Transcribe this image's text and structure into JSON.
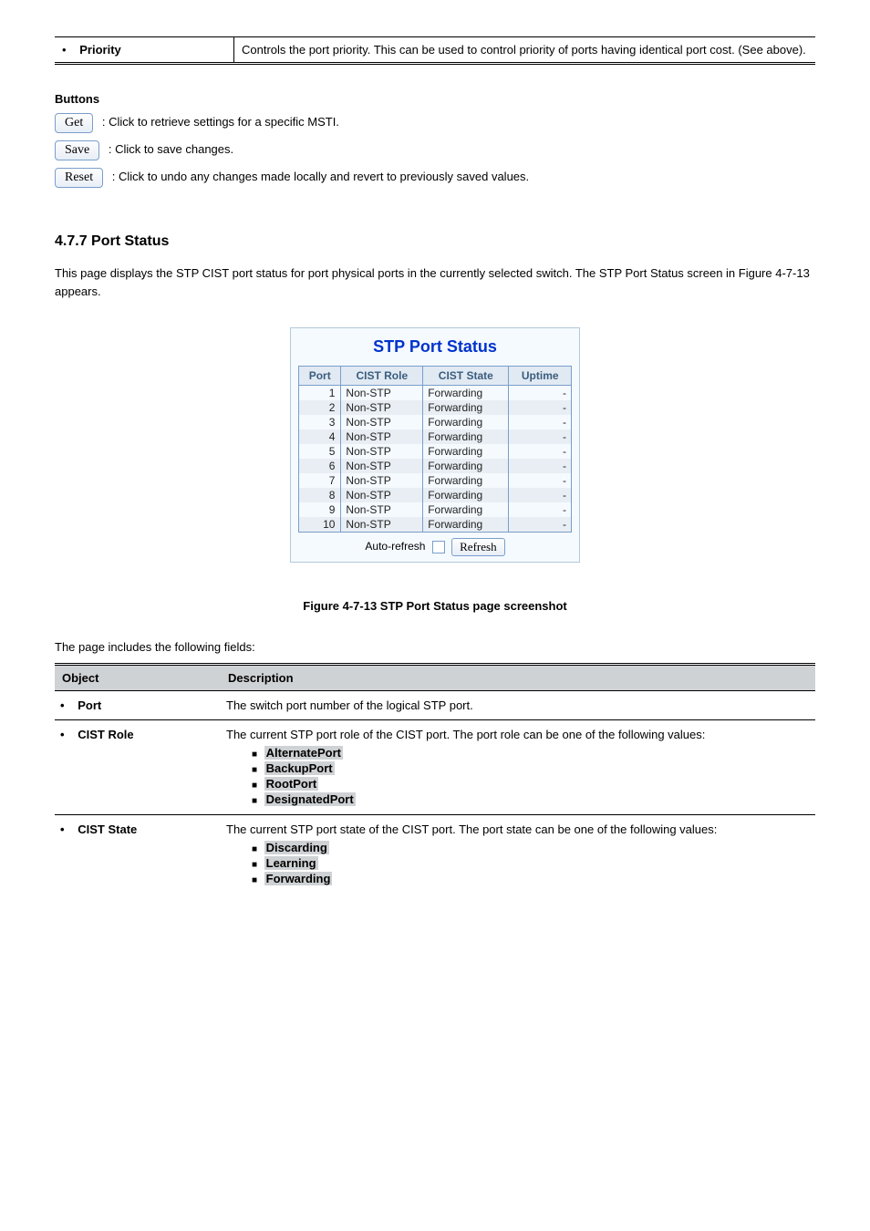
{
  "row1": {
    "label": "Priority",
    "desc": "Controls the port priority. This can be used to control priority of ports having identical port cost. (See above)."
  },
  "buttons": {
    "intro": "Buttons",
    "get": "Get",
    "get_desc": ": Click to retrieve settings for a specific MSTI.",
    "save": "Save",
    "save_desc": ": Click to save changes.",
    "reset": "Reset",
    "reset_desc": ": Click to undo any changes made locally and revert to previously saved values."
  },
  "section": {
    "heading": "4.7.7 Port Status",
    "body": "This page displays the STP CIST port status for port physical ports in the currently selected switch. The STP Port Status screen in Figure 4-7-13 appears."
  },
  "panel": {
    "title": "STP Port Status",
    "headers": [
      "Port",
      "CIST Role",
      "CIST State",
      "Uptime"
    ],
    "rows": [
      {
        "port": "1",
        "role": "Non-STP",
        "state": "Forwarding",
        "uptime": "-"
      },
      {
        "port": "2",
        "role": "Non-STP",
        "state": "Forwarding",
        "uptime": "-"
      },
      {
        "port": "3",
        "role": "Non-STP",
        "state": "Forwarding",
        "uptime": "-"
      },
      {
        "port": "4",
        "role": "Non-STP",
        "state": "Forwarding",
        "uptime": "-"
      },
      {
        "port": "5",
        "role": "Non-STP",
        "state": "Forwarding",
        "uptime": "-"
      },
      {
        "port": "6",
        "role": "Non-STP",
        "state": "Forwarding",
        "uptime": "-"
      },
      {
        "port": "7",
        "role": "Non-STP",
        "state": "Forwarding",
        "uptime": "-"
      },
      {
        "port": "8",
        "role": "Non-STP",
        "state": "Forwarding",
        "uptime": "-"
      },
      {
        "port": "9",
        "role": "Non-STP",
        "state": "Forwarding",
        "uptime": "-"
      },
      {
        "port": "10",
        "role": "Non-STP",
        "state": "Forwarding",
        "uptime": "-"
      }
    ],
    "auto_refresh_label": "Auto-refresh",
    "refresh_label": "Refresh"
  },
  "figcaption": "Figure 4-7-13 STP Port Status page screenshot",
  "desc_intro": "The page includes the following fields:",
  "desc_headers": {
    "object": "Object",
    "description": "Description"
  },
  "desc": {
    "port": {
      "label": "Port",
      "text": "The switch port number of the logical STP port."
    },
    "cistrole": {
      "label": "CIST Role",
      "lead": "The current STP port role of the CIST port. The port role can be one of the following values:",
      "items": [
        "AlternatePort",
        "BackupPort",
        "RootPort",
        "DesignatedPort"
      ]
    },
    "ciststate": {
      "label": "CIST State",
      "lead": "The current STP port state of the CIST port. The port state can be one of the following values:",
      "items": [
        "Discarding",
        "Learning",
        "Forwarding"
      ]
    }
  }
}
